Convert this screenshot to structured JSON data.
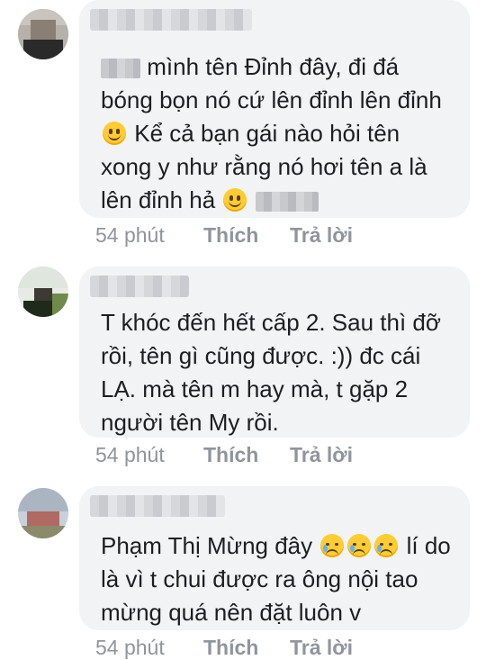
{
  "comments": [
    {
      "name_hidden": true,
      "text_parts": [
        "mình tên Đỉnh đây, đi đá bóng bọn nó cứ lên đỉnh lên đỉnh",
        "Kể cả bạn gái nào hỏi tên xong y như rằng nó hơi tên a là lên đỉnh hả"
      ],
      "emojis": [
        "slightly-smiling-face",
        "slightly-smiling-face"
      ],
      "time": "54 phút",
      "like": "Thích",
      "reply": "Trả lời"
    },
    {
      "name_hidden": true,
      "text": "T khóc đến hết cấp 2. Sau thì đỡ rồi, tên gì cũng được. :)) đc cái LẠ. mà tên m hay mà, t gặp 2 người tên My rồi.",
      "time": "54 phút",
      "like": "Thích",
      "reply": "Trả lời"
    },
    {
      "name_hidden": true,
      "text_parts": [
        "Phạm Thị Mừng đây",
        "lí do là vì t chui được ra ông nội tao mừng quá nên đặt luôn v"
      ],
      "emojis": [
        "crying-face",
        "crying-face",
        "crying-face"
      ],
      "time": "54 phút",
      "like": "Thích",
      "reply": "Trả lời"
    }
  ],
  "colors": {
    "bubble": "#f2f3f5",
    "text": "#1c1e21",
    "meta": "#90949c",
    "emoji": "#ffcc33"
  }
}
